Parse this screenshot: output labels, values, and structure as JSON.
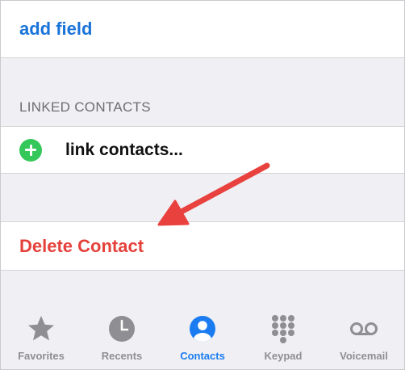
{
  "colors": {
    "link_blue": "#1a73d9",
    "destructive_red": "#e5413b",
    "add_green": "#34c759",
    "tab_active": "#1a7cf0",
    "tab_inactive": "#8e8e93",
    "annotation_arrow": "#e8413e"
  },
  "add_field": {
    "label": "add field"
  },
  "linked_contacts": {
    "header": "LINKED CONTACTS",
    "link_label": "link contacts...",
    "icon": "plus-circle-icon"
  },
  "delete_contact": {
    "label": "Delete Contact"
  },
  "annotation": {
    "type": "arrow",
    "points_to": "Delete Contact"
  },
  "tabbar": {
    "tabs": [
      {
        "label": "Favorites",
        "icon": "star-icon",
        "active": false
      },
      {
        "label": "Recents",
        "icon": "clock-icon",
        "active": false
      },
      {
        "label": "Contacts",
        "icon": "person-icon",
        "active": true
      },
      {
        "label": "Keypad",
        "icon": "keypad-icon",
        "active": false
      },
      {
        "label": "Voicemail",
        "icon": "voicemail-icon",
        "active": false
      }
    ]
  }
}
